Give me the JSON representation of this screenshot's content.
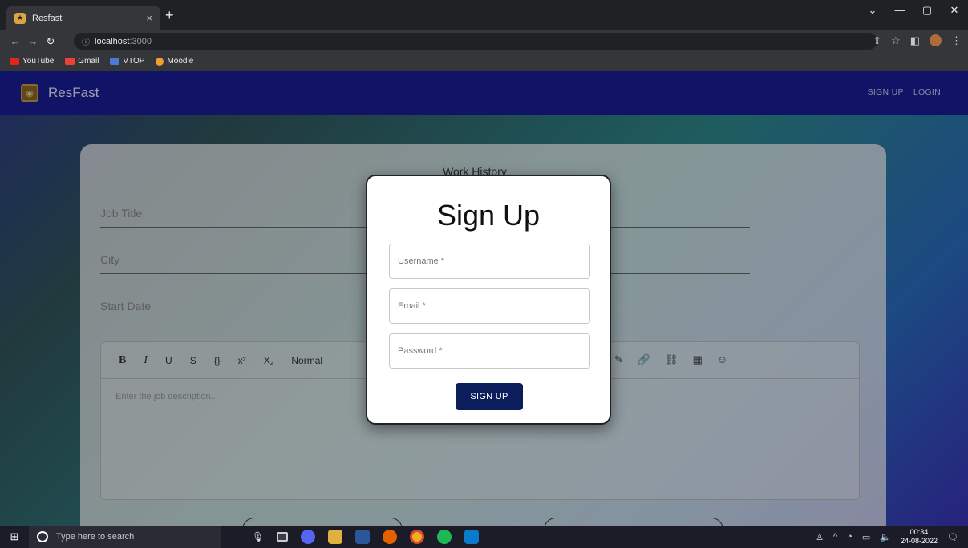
{
  "browser": {
    "tab_title": "Resfast",
    "tab_close": "×",
    "new_tab": "+",
    "window_controls": [
      "⌄",
      "—",
      "▢",
      "✕"
    ],
    "url_host": "localhost",
    "url_port": ":3000",
    "bookmarks": [
      {
        "label": "YouTube",
        "color": "#e0261b"
      },
      {
        "label": "Gmail",
        "color": "#ea4335"
      },
      {
        "label": "VTOP",
        "color": "#4a7bd1"
      },
      {
        "label": "Moodle",
        "color": "#f0a030"
      }
    ]
  },
  "app": {
    "brand": "ResFast",
    "nav": {
      "signup": "SIGN UP",
      "login": "LOGIN"
    }
  },
  "form": {
    "section_title": "Work History",
    "job_title": "Job Title",
    "city": "City",
    "start_date": "Start Date",
    "toolbar": {
      "bold": "B",
      "italic": "I",
      "underline": "U",
      "strike": "S",
      "code": "{}",
      "sup": "x²",
      "sub": "X₂",
      "style": "Normal"
    },
    "editor_placeholder": "Enter the job description..."
  },
  "modal": {
    "title": "Sign Up",
    "username_placeholder": "Username *",
    "email_placeholder": "Email *",
    "password_placeholder": "Password *",
    "submit": "SIGN UP"
  },
  "taskbar": {
    "search_placeholder": "Type here to search",
    "time": "00:34",
    "date": "24-08-2022"
  },
  "colors": {
    "appbar": "#1a1d98",
    "submit_button": "#0b1e5b"
  }
}
